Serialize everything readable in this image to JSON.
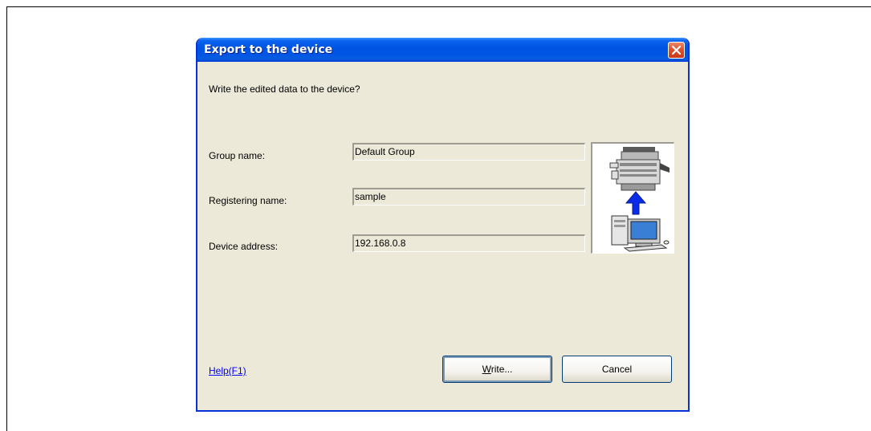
{
  "dialog": {
    "title": "Export to the device",
    "prompt": "Write the edited data to the device?",
    "fields": [
      {
        "label": "Group name:",
        "value": "Default Group"
      },
      {
        "label": "Registering name:",
        "value": "sample"
      },
      {
        "label": "Device address:",
        "value": "192.168.0.8"
      }
    ],
    "help_link": "Help(F1)",
    "write_button": {
      "mnemonic": "W",
      "rest": "rite..."
    },
    "cancel_button": "Cancel",
    "icons": [
      "close-icon",
      "copier-icon",
      "upload-arrow-icon",
      "computer-icon"
    ]
  }
}
